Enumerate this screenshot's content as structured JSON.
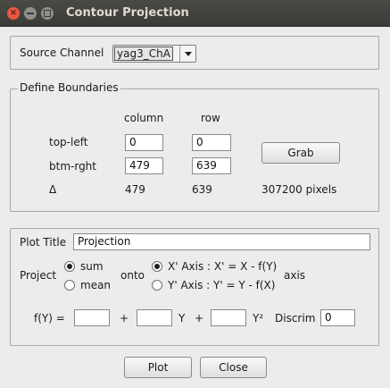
{
  "window": {
    "title": "Contour Projection"
  },
  "source": {
    "label": "Source Channel",
    "selected": "yag3_ChA"
  },
  "boundaries": {
    "legend": "Define Boundaries",
    "col_header": "column",
    "row_header": "row",
    "top_left_label": "top-left",
    "btm_right_label": "btm-rght",
    "delta_label": "Δ",
    "top_left_col": "0",
    "top_left_row": "0",
    "btm_right_col": "479",
    "btm_right_row": "639",
    "delta_col": "479",
    "delta_row": "639",
    "pixels": "307200 pixels",
    "grab_label": "Grab"
  },
  "plot": {
    "title_label": "Plot Title",
    "title_value": "Projection",
    "project_label": "Project",
    "sum_label": "sum",
    "mean_label": "mean",
    "onto_label": "onto",
    "xaxis_label": "X' Axis : X' = X - f(Y)",
    "yaxis_label": "Y' Axis : Y' = Y - f(X)",
    "axis_label": "axis",
    "fy_label": "f(Y) =",
    "plus1": "+",
    "y_label": "Y",
    "plus2": "+",
    "y2_label": "Y²",
    "discrim_label": "Discrim",
    "discrim_value": "0",
    "coef0": "",
    "coef1": "",
    "coef2": ""
  },
  "buttons": {
    "plot": "Plot",
    "close": "Close"
  }
}
